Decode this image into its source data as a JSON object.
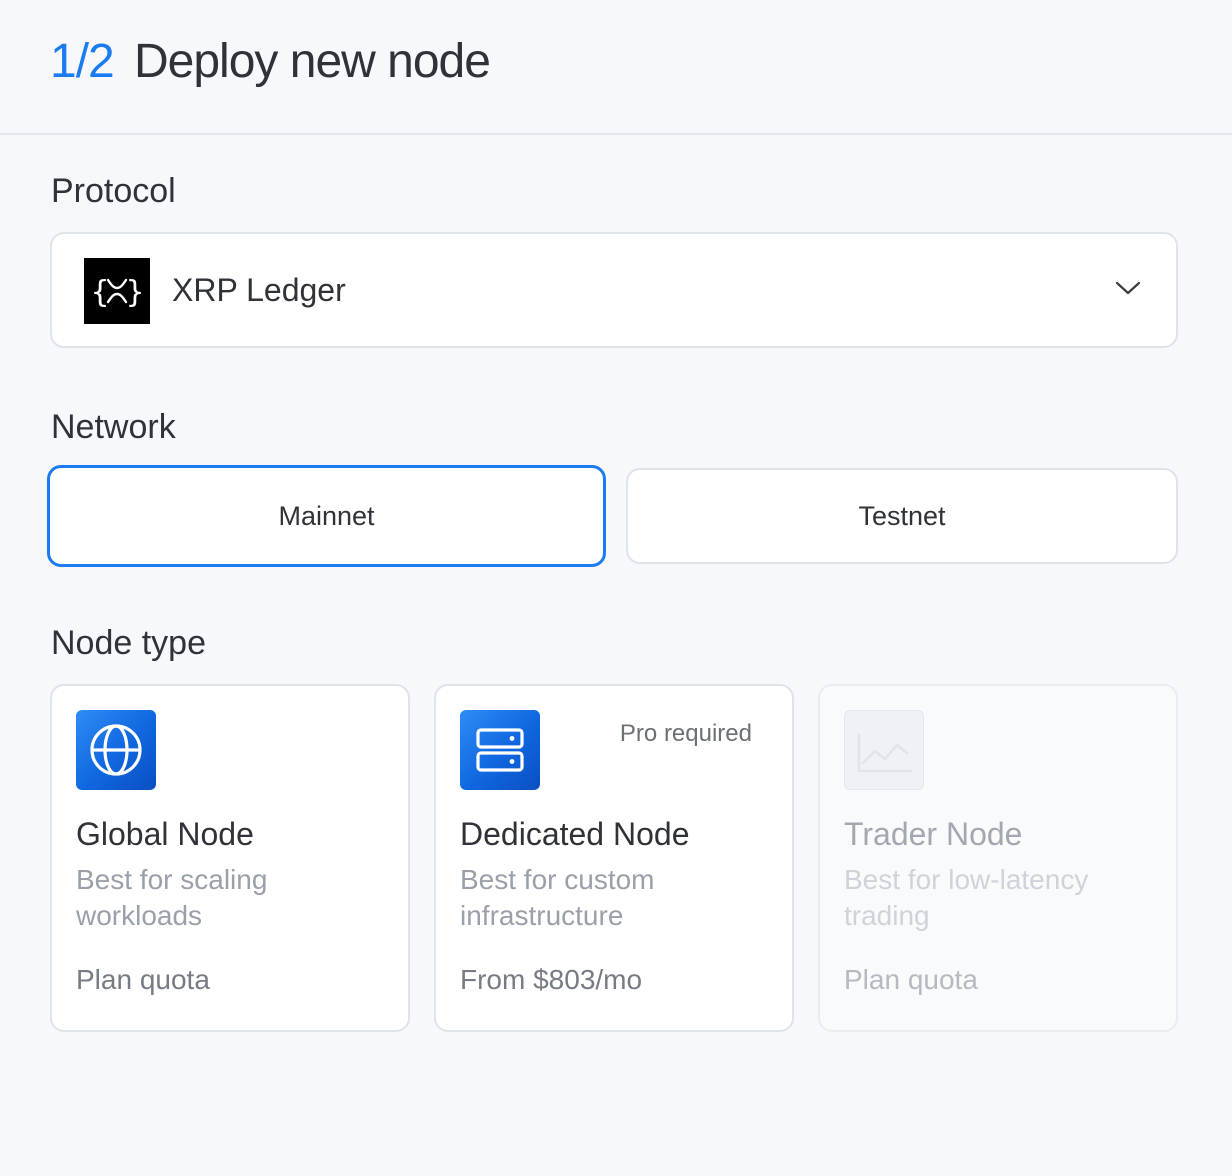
{
  "header": {
    "step": "1/2",
    "title": "Deploy new node"
  },
  "protocol": {
    "label": "Protocol",
    "selected": "XRP Ledger",
    "logo_icon": "xrp-ledger-logo-icon",
    "dropdown_icon": "chevron-down-icon"
  },
  "network": {
    "label": "Network",
    "options": [
      {
        "label": "Mainnet",
        "selected": true
      },
      {
        "label": "Testnet",
        "selected": false
      }
    ]
  },
  "node_type": {
    "label": "Node type",
    "cards": [
      {
        "name": "Global Node",
        "description": "Best for scaling workloads",
        "price": "Plan quota",
        "badge": "",
        "icon": "globe-icon",
        "enabled": true
      },
      {
        "name": "Dedicated Node",
        "description": "Best for custom infrastructure",
        "price": "From $803/mo",
        "badge": "Pro required",
        "icon": "server-icon",
        "enabled": true
      },
      {
        "name": "Trader Node",
        "description": "Best for low-latency trading",
        "price": "Plan quota",
        "badge": "",
        "icon": "chart-line-icon",
        "enabled": false
      }
    ]
  },
  "colors": {
    "accent": "#1a7cf0",
    "background": "#f6f8fc",
    "text": "#2f3237",
    "muted": "#9aa0a9"
  }
}
